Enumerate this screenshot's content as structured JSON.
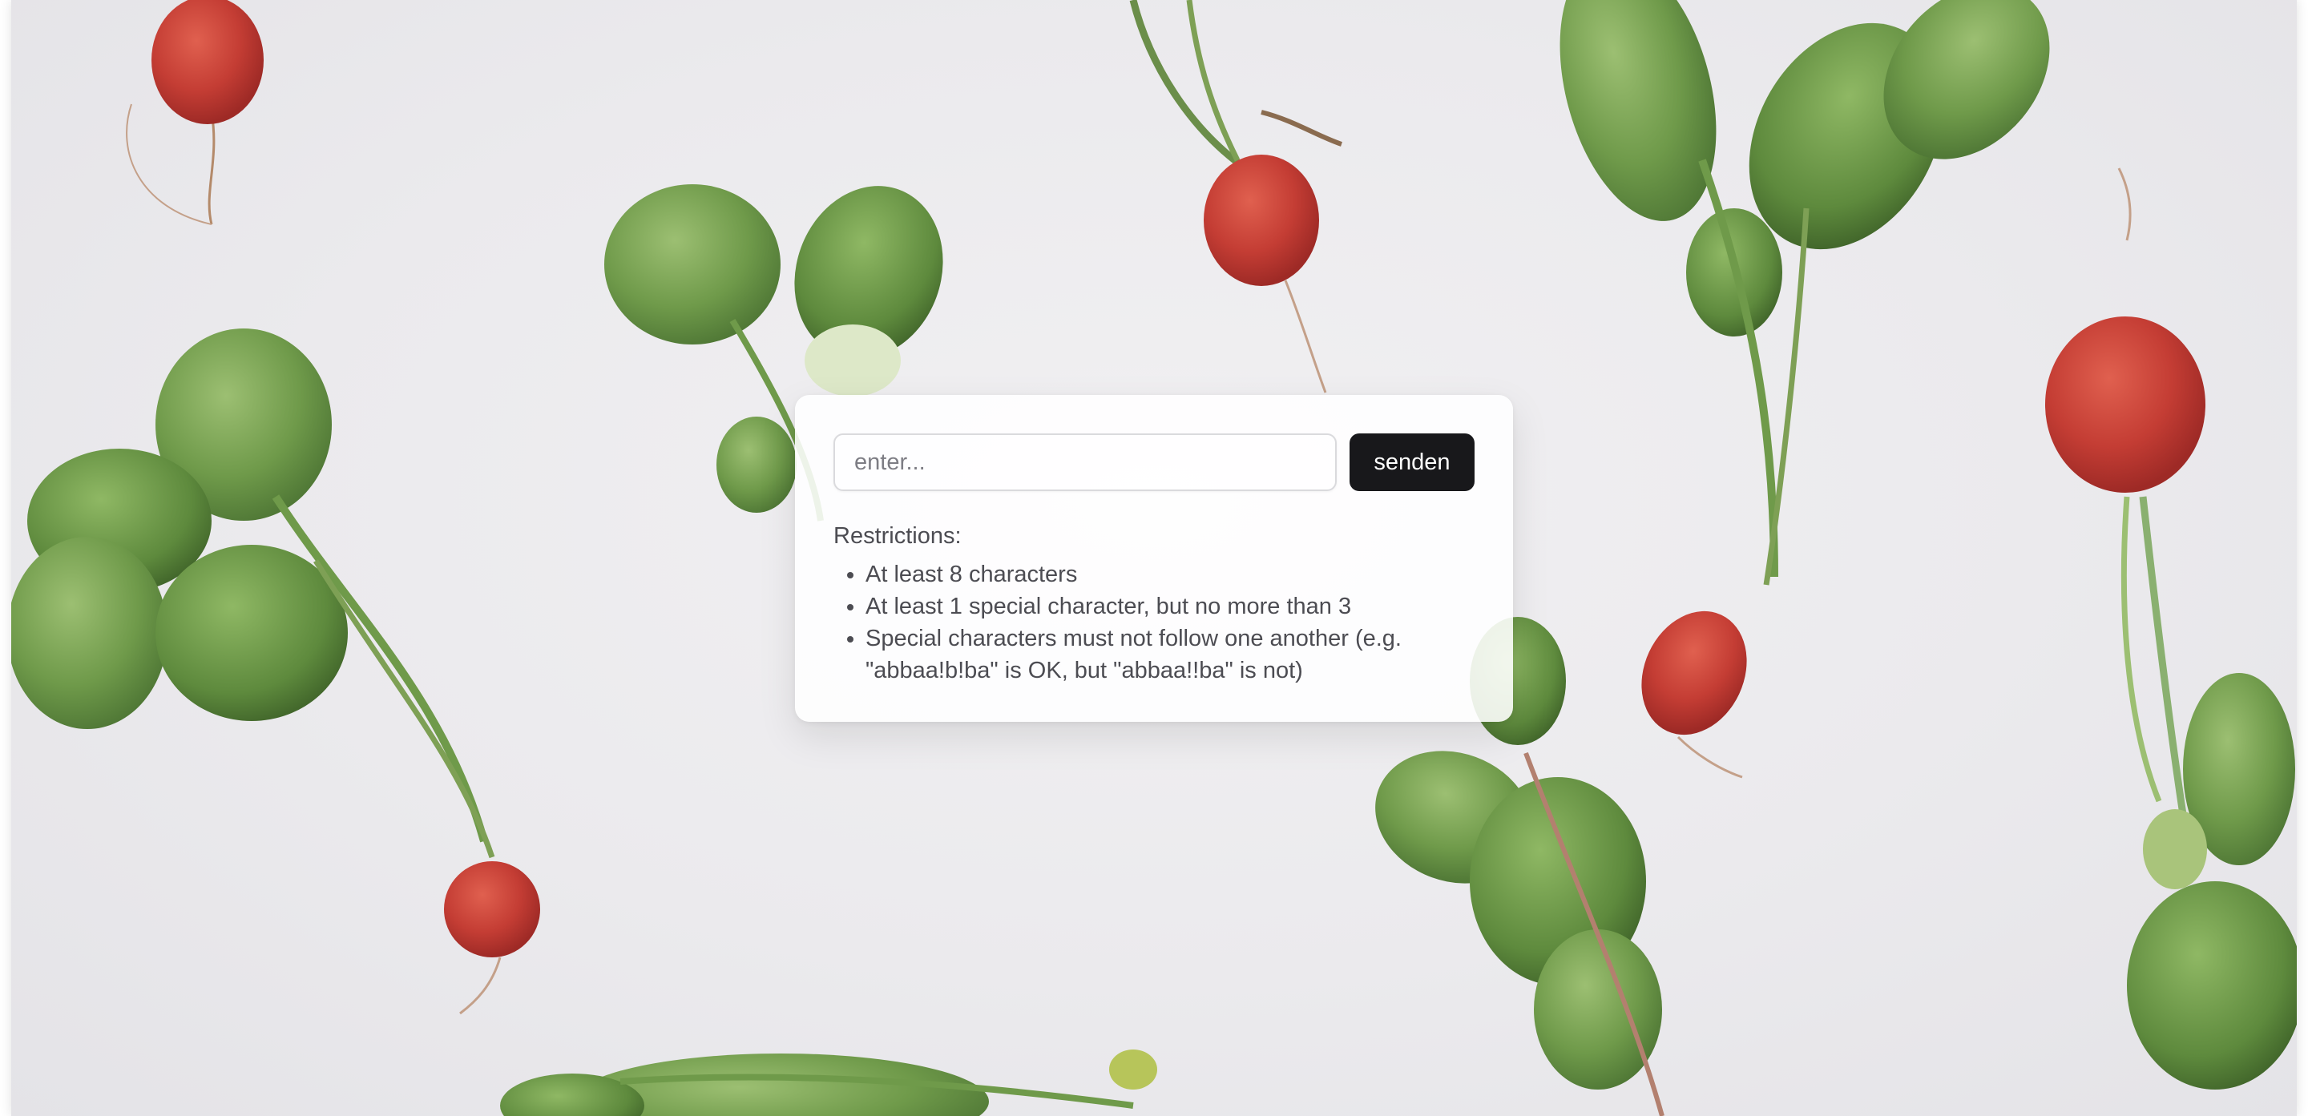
{
  "form": {
    "input_placeholder": "enter...",
    "input_value": "",
    "submit_label": "senden"
  },
  "restrictions": {
    "title": "Restrictions:",
    "items": [
      "At least 8 characters",
      "At least 1 special character, but no more than 3",
      "Special characters must not follow one another (e.g. \"abbaa!b!ba\" is OK, but \"abbaa!!ba\" is not)"
    ]
  },
  "colors": {
    "button_background": "#18181b",
    "button_text": "#ffffff",
    "card_background": "#ffffff",
    "text": "#4c4c52"
  },
  "background": {
    "image_subject": "radishes-on-white-background"
  }
}
